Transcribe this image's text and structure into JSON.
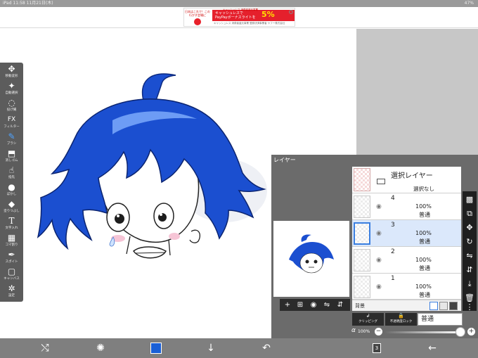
{
  "status_bar": {
    "left": "iPad  11:58 11月21日(木)",
    "right": "47%"
  },
  "ad": {
    "left_text": "日本はこれで！この行かず会場に",
    "top_line": "キャッシュレス 消費者還元事業",
    "main_line1": "キャッシュレスで",
    "main_line2": "PayPayボーナスライトを",
    "percent": "5%",
    "percent_suffix": "還元",
    "sub_line": "キャッシュレス 消費者還元事業 登録決済事業者 ヤフー株式会社"
  },
  "toolbar": {
    "tools": [
      {
        "label": "移動変形",
        "icon": "✥"
      },
      {
        "label": "自動選択",
        "icon": "✦"
      },
      {
        "label": "投げ縄",
        "icon": "◌"
      },
      {
        "label": "フィルター",
        "icon": "FX"
      },
      {
        "label": "ブラシ",
        "icon": "✎"
      },
      {
        "label": "消しゴム",
        "icon": "⬒"
      },
      {
        "label": "指先",
        "icon": "☝"
      },
      {
        "label": "ぼかし",
        "icon": "●"
      },
      {
        "label": "塗りつぶし",
        "icon": "◆"
      },
      {
        "label": "文字入れ",
        "icon": "T"
      },
      {
        "label": "コマ割り",
        "icon": "▦"
      },
      {
        "label": "スポイト",
        "icon": "✒"
      },
      {
        "label": "キャンバス",
        "icon": "▢"
      },
      {
        "label": "設定",
        "icon": "✲"
      }
    ]
  },
  "layer_panel": {
    "title": "レイヤー",
    "selection_layer": {
      "title": "選択レイヤー",
      "status": "選択なし"
    },
    "layers": [
      {
        "name": "4",
        "opacity": "100%",
        "mode": "普通"
      },
      {
        "name": "3",
        "opacity": "100%",
        "mode": "普通"
      },
      {
        "name": "2",
        "opacity": "100%",
        "mode": "普通"
      },
      {
        "name": "1",
        "opacity": "100%",
        "mode": "普通"
      }
    ],
    "background_label": "背景",
    "clipping_label": "クリッピング",
    "lock_label": "不透明度ロック",
    "blend_mode": "普通",
    "alpha_symbol": "α",
    "alpha_value": "100%"
  },
  "bottom": {
    "layer_count": "3"
  },
  "colors": {
    "brush": "#1a5fd6",
    "accent": "#3b7fe0"
  }
}
